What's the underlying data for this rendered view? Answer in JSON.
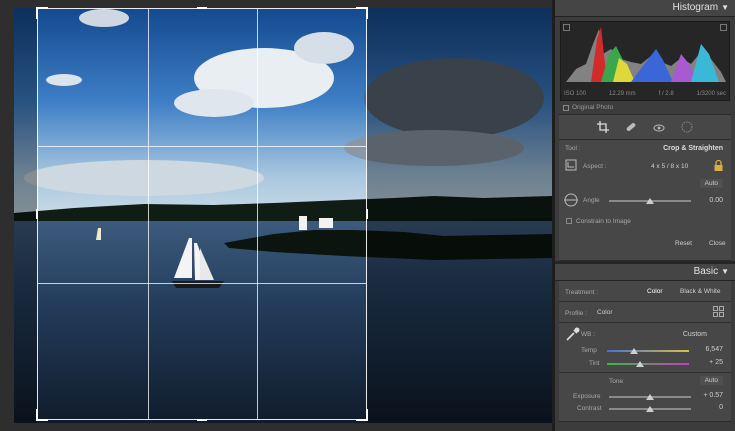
{
  "histogram": {
    "title": "Histogram",
    "iso": "ISO 100",
    "focal": "12.29 mm",
    "aperture": "f / 2.8",
    "shutter": "1/3200 sec",
    "original_photo": "Original Photo"
  },
  "crop": {
    "tool_label": "Tool :",
    "tool_name": "Crop & Straighten",
    "aspect_label": "Aspect :",
    "aspect_value": "4 x 5  /  8 x 10",
    "auto_label": "Auto",
    "angle_label": "Angle",
    "angle_value": "0.00",
    "angle_level": 0.5,
    "constrain_label": "Constrain to Image",
    "reset_label": "Reset",
    "close_label": "Close"
  },
  "basic": {
    "title": "Basic",
    "treatment_label": "Treatment :",
    "treatment_color": "Color",
    "treatment_bw": "Black & White",
    "profile_label": "Profile :",
    "profile_value": "Color",
    "wb_label": "WB :",
    "wb_value": "Custom",
    "temp_label": "Temp",
    "temp_value": "6,547",
    "temp_level": 0.33,
    "tint_label": "Tint",
    "tint_value": "+ 25",
    "tint_level": 0.4,
    "tone_label": "Tone",
    "tone_auto": "Auto",
    "exposure_label": "Exposure",
    "exposure_value": "+ 0.57",
    "exposure_level": 0.5,
    "contrast_label": "Contrast",
    "contrast_value": "0",
    "contrast_level": 0.5
  },
  "colors": {
    "panel_bg": "#3c3c3c",
    "sky": "#1f5fb4",
    "water": "#1d3450"
  },
  "icons": [
    "crop-overlay-icon",
    "spot-removal-icon",
    "red-eye-icon",
    "graduated-filter-icon",
    "lock-icon",
    "eyedropper-icon",
    "grid-icon",
    "straighten-tool-icon",
    "aspect-icon"
  ]
}
